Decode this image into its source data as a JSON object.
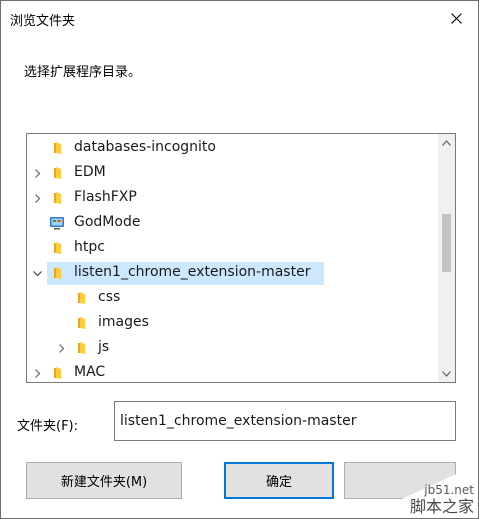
{
  "window": {
    "title": "浏览文件夹",
    "close_icon": "close-icon"
  },
  "instruction": "选择扩展程序目录。",
  "tree": {
    "items": [
      {
        "label": "databases-incognito",
        "level": 0,
        "expander": "none",
        "icon": "folder-icon"
      },
      {
        "label": "EDM",
        "level": 0,
        "expander": "collapsed",
        "icon": "folder-icon"
      },
      {
        "label": "FlashFXP",
        "level": 0,
        "expander": "collapsed",
        "icon": "folder-icon"
      },
      {
        "label": "GodMode",
        "level": 0,
        "expander": "none",
        "icon": "control-panel-icon"
      },
      {
        "label": "htpc",
        "level": 0,
        "expander": "none",
        "icon": "folder-icon"
      },
      {
        "label": "listen1_chrome_extension-master",
        "level": 0,
        "expander": "expanded",
        "icon": "folder-icon",
        "selected": true
      },
      {
        "label": "css",
        "level": 1,
        "expander": "none",
        "icon": "folder-icon"
      },
      {
        "label": "images",
        "level": 1,
        "expander": "none",
        "icon": "folder-icon"
      },
      {
        "label": "js",
        "level": 1,
        "expander": "collapsed",
        "icon": "folder-icon"
      },
      {
        "label": "MAC",
        "level": 0,
        "expander": "collapsed",
        "icon": "folder-icon"
      }
    ]
  },
  "folder_field": {
    "label": "文件夹(F):",
    "value": "listen1_chrome_extension-master"
  },
  "buttons": {
    "new_folder": "新建文件夹(M)",
    "ok": "确定",
    "cancel": ""
  },
  "watermark": {
    "line1": "jb51.net",
    "line2": "脚本之家"
  },
  "colors": {
    "selection": "#cce8ff",
    "accent": "#0078d7",
    "folder": "#ffcb3d"
  }
}
